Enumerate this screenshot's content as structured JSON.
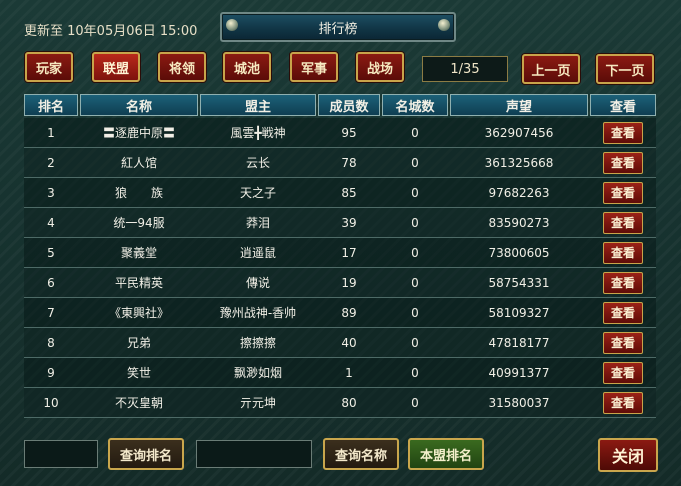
{
  "update_time": "更新至 10年05月06日 15:00",
  "title": "排行榜",
  "tabs": [
    "玩家",
    "联盟",
    "将领",
    "城池",
    "军事",
    "战场"
  ],
  "active_tab": 1,
  "pager": {
    "text": "1/35",
    "prev": "上一页",
    "next": "下一页"
  },
  "columns": [
    "排名",
    "名称",
    "盟主",
    "成员数",
    "名城数",
    "声望",
    "查看"
  ],
  "rows": [
    {
      "rank": "1",
      "name": "〓逐鹿中原〓",
      "leader": "風雲╋戦神",
      "members": "95",
      "cities": "0",
      "fame": "362907456",
      "view": "查看"
    },
    {
      "rank": "2",
      "name": "紅人馆",
      "leader": "云长",
      "members": "78",
      "cities": "0",
      "fame": "361325668",
      "view": "查看"
    },
    {
      "rank": "3",
      "name": "狼　　族",
      "leader": "天之子",
      "members": "85",
      "cities": "0",
      "fame": "97682263",
      "view": "查看"
    },
    {
      "rank": "4",
      "name": "统一94服",
      "leader": "莽泪",
      "members": "39",
      "cities": "0",
      "fame": "83590273",
      "view": "查看"
    },
    {
      "rank": "5",
      "name": "聚義堂",
      "leader": "逍遥鼠",
      "members": "17",
      "cities": "0",
      "fame": "73800605",
      "view": "查看"
    },
    {
      "rank": "6",
      "name": "平民精英",
      "leader": "傳说",
      "members": "19",
      "cities": "0",
      "fame": "58754331",
      "view": "查看"
    },
    {
      "rank": "7",
      "name": "《東興社》",
      "leader": "豫州战神-香帅",
      "members": "89",
      "cities": "0",
      "fame": "58109327",
      "view": "查看"
    },
    {
      "rank": "8",
      "name": "兄弟",
      "leader": "擦擦擦",
      "members": "40",
      "cities": "0",
      "fame": "47818177",
      "view": "查看"
    },
    {
      "rank": "9",
      "name": "笑世",
      "leader": "飘渺如烟",
      "members": "1",
      "cities": "0",
      "fame": "40991377",
      "view": "查看"
    },
    {
      "rank": "10",
      "name": "不灭皇朝",
      "leader": "亓元坤",
      "members": "80",
      "cities": "0",
      "fame": "31580037",
      "view": "查看"
    }
  ],
  "bottom": {
    "query_rank": "查询排名",
    "query_name": "查询名称",
    "my_alliance_rank": "本盟排名",
    "close": "关闭"
  }
}
